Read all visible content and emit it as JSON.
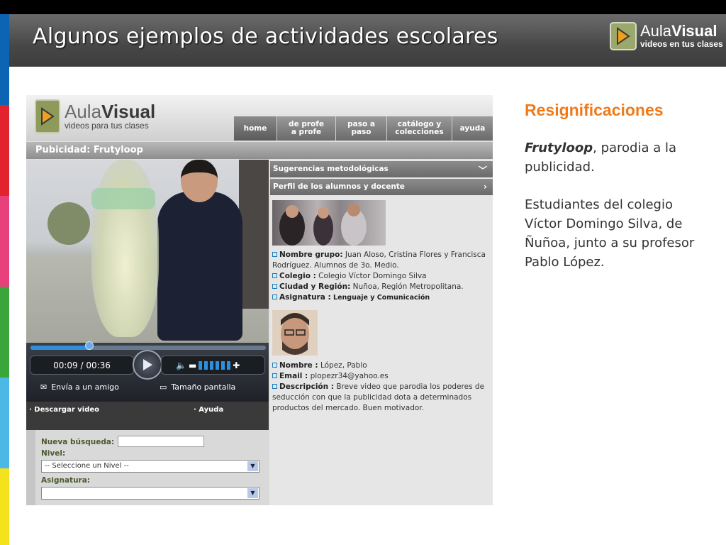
{
  "slide": {
    "title": "Algunos ejemplos de actividades escolares",
    "brand": {
      "name_light": "Aula",
      "name_bold": "Visual",
      "tagline": "videos en tus clases"
    },
    "strip_colors": [
      "#0b64b4",
      "#e2222c",
      "#e8407a",
      "#3aa53a",
      "#4cb8e6",
      "#f4e21c"
    ]
  },
  "web": {
    "logo": {
      "name_light": "Aula",
      "name_bold": "Visual",
      "tagline": "videos para tus clases"
    },
    "nav": [
      "home",
      "de profe\na profe",
      "paso a\npaso",
      "catálogo y\ncolecciones",
      "ayuda"
    ],
    "section_title": "Pubicidad: Frutyloop",
    "player": {
      "time": "00:09 / 00:36",
      "progress": 0.25,
      "send_label": "Envía a un amigo",
      "size_label": "Tamaño pantalla"
    },
    "links": {
      "download": "· Descargar video",
      "help": "· Ayuda"
    },
    "search": {
      "new_search_label": "Nueva búsqueda:",
      "level_label": "Nivel:",
      "level_value": "-- Seleccione un Nivel --",
      "subject_label": "Asignatura:",
      "subject_value": ""
    },
    "accordion": {
      "suggestions": "Sugerencias metodológicas",
      "profile": "Perfil de los alumnos y docente"
    },
    "group": {
      "name_label": "Nombre grupo:",
      "name_value": "Juan Aloso, Cristina Flores y Francisca Rodríguez. Alumnos de 3o. Medio.",
      "school_label": "Colegio :",
      "school_value": "Colegio Víctor Domingo Silva",
      "city_label": "Ciudad y Región:",
      "city_value": "Nuñoa, Región Metropolitana.",
      "subject_label": "Asignatura :",
      "subject_value": "Lenguaje y Comunicación"
    },
    "teacher": {
      "name_label": "Nombre :",
      "name_value": "López, Pablo",
      "email_label": "Email :",
      "email_value": "plopezr34@yahoo.es",
      "desc_label": "Descripción :",
      "desc_value": "Breve video que parodia los poderes de seducción con que la publicidad dota a determinados productos del mercado. Buen motivador."
    }
  },
  "side": {
    "heading": "Resignificaciones",
    "p1_title": "Frutyloop",
    "p1_rest": ", parodia a la publicidad.",
    "p2": "Estudiantes del colegio Víctor Domingo Silva, de Ñuñoa, junto a su profesor Pablo López."
  },
  "colors": {
    "accent": "#f07a1a",
    "title_bar": "#4a4a4a"
  }
}
